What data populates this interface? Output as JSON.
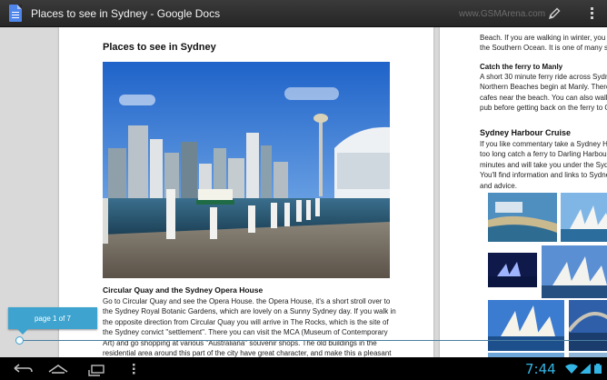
{
  "window": {
    "title": "Places to see in Sydney - Google Docs",
    "watermark": "www.GSMArena.com",
    "edit_icon": "pencil-icon",
    "menu_icon": "overflow-menu-icon",
    "app_icon": "google-docs-icon"
  },
  "page1": {
    "title": "Places to see in Sydney",
    "section_heading": "Circular Quay and the Sydney Opera House",
    "paragraph": [
      "Go to Circular Quay and see the Opera House. the Opera House, it's a short stroll over to",
      "the Sydney Royal Botanic Gardens, which are lovely on a Sunny Sydney day. If you walk in",
      "the opposite direction from Circular Quay you will arrive in The Rocks, which is the site of",
      "the Sydney convict \"settlement\". There you can visit the MCA (Museum of Contemporary",
      "Art) and go shopping at various \"Australiana\" souvenir shops. The old buildings in the",
      "residential area around this part of the city have great character, and make this a pleasant"
    ]
  },
  "page2": {
    "intro_lines": [
      "Beach. If you are walking in winter, you m",
      "the Southern Ocean. It is one of many stu"
    ],
    "ferry_heading": "Catch the ferry to Manly",
    "ferry_lines": [
      "A short 30 minute ferry ride across Sydne",
      "Northern Beaches begin at Manly. There a",
      "cafes near the beach. You can also walk a",
      "pub before getting back on the ferry to Ci"
    ],
    "cruise_heading": "Sydney Harbour Cruise",
    "cruise_lines": [
      "If you like commentary take a Sydney Har",
      "too long catch a ferry to Darling Harbour",
      "minutes and will take you under the Sydn",
      "You'll find information and links to Sydne",
      "and advice."
    ]
  },
  "scrubber": {
    "page_label": "page 1 of 7",
    "current_page": 1,
    "total_pages": 7
  },
  "system_bar": {
    "time": "7:44",
    "back_icon": "back-icon",
    "home_icon": "home-icon",
    "recents_icon": "recent-apps-icon",
    "menu_icon": "menu-icon",
    "wifi_icon": "wifi-icon",
    "signal_icon": "signal-icon",
    "battery_icon": "battery-icon",
    "accent": "#33b5e5"
  }
}
